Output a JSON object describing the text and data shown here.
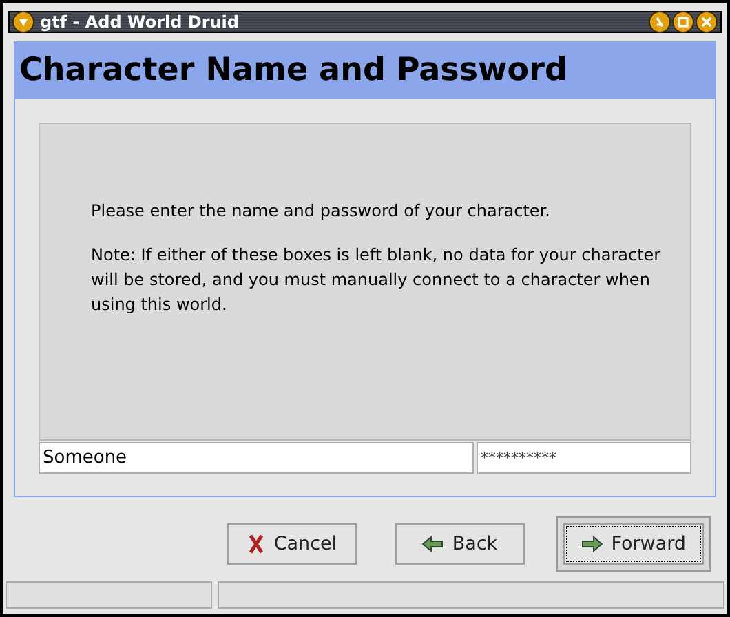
{
  "window": {
    "title": "gtf - Add World Druid"
  },
  "header": {
    "title": "Character Name and Password"
  },
  "message": [
    "Please enter the name and password of your character.",
    "Note: If either of these boxes is left blank, no data for your character will be stored, and you must manually connect to a character when using this world."
  ],
  "fields": [
    {
      "kind": "text",
      "value": "Someone"
    },
    {
      "kind": "password",
      "value": "**********"
    }
  ],
  "buttons": [
    {
      "label": "Cancel",
      "kind": "cancel",
      "default": false
    },
    {
      "label": "Back",
      "kind": "back",
      "default": false
    },
    {
      "label": "Forward",
      "kind": "forward",
      "default": true
    }
  ]
}
